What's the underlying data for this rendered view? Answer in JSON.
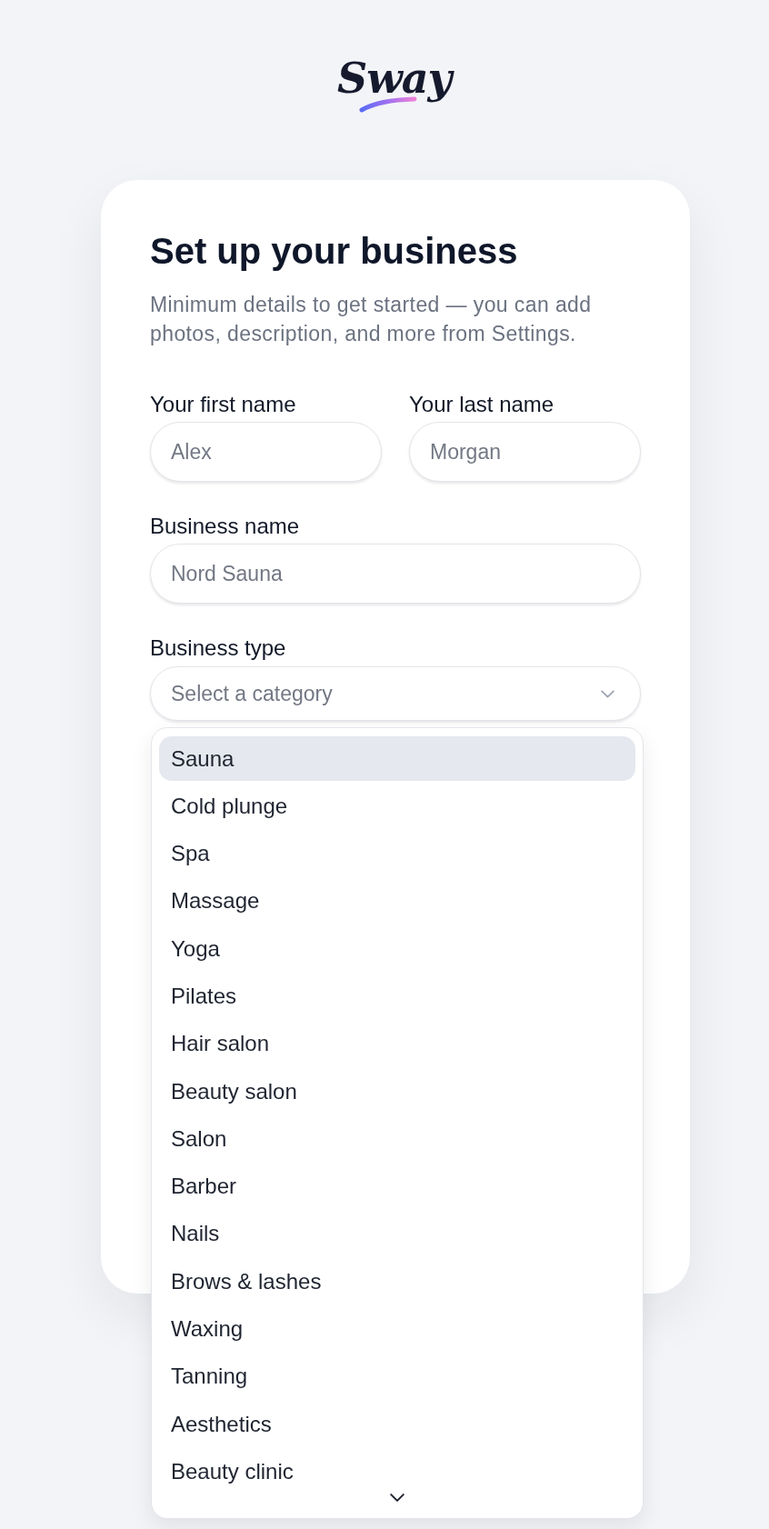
{
  "logo": {
    "text": "Sway"
  },
  "card": {
    "title": "Set up your business",
    "subtitle": "Minimum details to get started — you can add photos, description, and more from Settings."
  },
  "name_fields": [
    {
      "label": "Your first name",
      "placeholder": "Alex"
    },
    {
      "label": "Your last name",
      "placeholder": "Morgan"
    }
  ],
  "business_name": {
    "label": "Business name",
    "placeholder": "Nord Sauna"
  },
  "business_type": {
    "label": "Business type",
    "placeholder": "Select a category",
    "expanded": true,
    "options": [
      {
        "label": "Sauna",
        "selected": true
      },
      {
        "label": "Cold plunge",
        "selected": false
      },
      {
        "label": "Spa",
        "selected": false
      },
      {
        "label": "Massage",
        "selected": false
      },
      {
        "label": "Yoga",
        "selected": false
      },
      {
        "label": "Pilates",
        "selected": false
      },
      {
        "label": "Hair salon",
        "selected": false
      },
      {
        "label": "Beauty salon",
        "selected": false
      },
      {
        "label": "Salon",
        "selected": false
      },
      {
        "label": "Barber",
        "selected": false
      },
      {
        "label": "Nails",
        "selected": false
      },
      {
        "label": "Brows & lashes",
        "selected": false
      },
      {
        "label": "Waxing",
        "selected": false
      },
      {
        "label": "Tanning",
        "selected": false
      },
      {
        "label": "Aesthetics",
        "selected": false
      },
      {
        "label": "Beauty clinic",
        "selected": false
      }
    ]
  }
}
